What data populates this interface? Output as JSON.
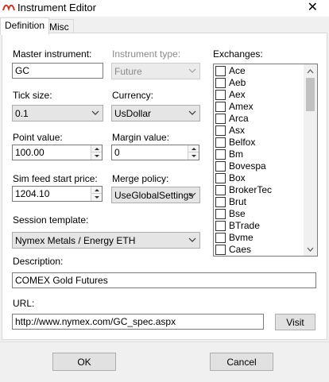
{
  "window": {
    "title": "Instrument Editor",
    "close_glyph": "✕",
    "icon": "app-logo-icon"
  },
  "tabs": [
    {
      "label": "Definition",
      "active": true
    },
    {
      "label": "Misc",
      "active": false
    }
  ],
  "fields": {
    "master_instrument": {
      "label": "Master instrument:",
      "value": "GC"
    },
    "instrument_type": {
      "label": "Instrument type:",
      "value": "Future",
      "disabled": true
    },
    "tick_size": {
      "label": "Tick size:",
      "value": "0.1"
    },
    "currency": {
      "label": "Currency:",
      "value": "UsDollar"
    },
    "point_value": {
      "label": "Point value:",
      "value": "100.00"
    },
    "margin_value": {
      "label": "Margin value:",
      "value": "0"
    },
    "sim_feed_start_price": {
      "label": "Sim feed start price:",
      "value": "1204.10"
    },
    "merge_policy": {
      "label": "Merge policy:",
      "value": "UseGlobalSettings"
    },
    "session_template": {
      "label": "Session template:",
      "value": "Nymex Metals / Energy ETH"
    },
    "description": {
      "label": "Description:",
      "value": "COMEX Gold Futures"
    },
    "url": {
      "label": "URL:",
      "value": "http://www.nymex.com/GC_spec.aspx"
    }
  },
  "exchanges": {
    "label": "Exchanges:",
    "items": [
      "Ace",
      "Aeb",
      "Aex",
      "Amex",
      "Arca",
      "Asx",
      "Belfox",
      "Bm",
      "Bovespa",
      "Box",
      "BrokerTec",
      "Brut",
      "Bse",
      "BTrade",
      "Bvme",
      "Caes"
    ]
  },
  "buttons": {
    "visit": "Visit",
    "ok": "OK",
    "cancel": "Cancel"
  }
}
